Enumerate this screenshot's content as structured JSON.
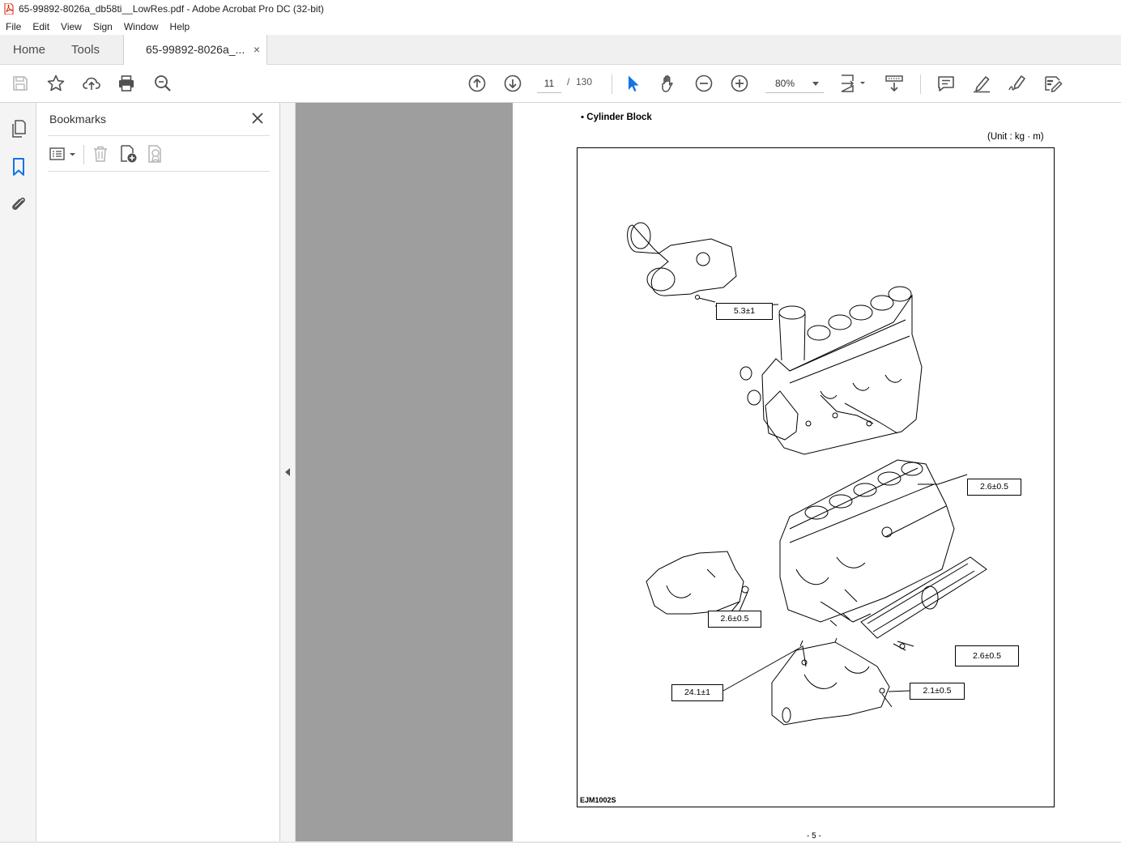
{
  "window": {
    "title": "65-99892-8026a_db58ti__LowRes.pdf - Adobe Acrobat Pro DC (32-bit)"
  },
  "menu": [
    "File",
    "Edit",
    "View",
    "Sign",
    "Window",
    "Help"
  ],
  "tabs": {
    "home": "Home",
    "tools": "Tools",
    "document": "65-99892-8026a_...",
    "close_glyph": "×"
  },
  "toolbar": {
    "current_page": "11",
    "page_separator": "/",
    "total_pages": "130",
    "zoom": "80%"
  },
  "bookmarks": {
    "title": "Bookmarks"
  },
  "document_page": {
    "heading": "▪ Cylinder Block",
    "unit": "(Unit : kg · m)",
    "figure_code": "EJM1002S",
    "page_number": "- 5 -",
    "torque_labels": [
      "5.3±1",
      "2.6±0.5",
      "2.6±0.5",
      "2.6±0.5",
      "24.1±1",
      "2.1±0.5"
    ]
  },
  "colors": {
    "accent_blue": "#1473e6",
    "pdf_red": "#d81e05",
    "gray_canvas": "#9e9e9e"
  }
}
